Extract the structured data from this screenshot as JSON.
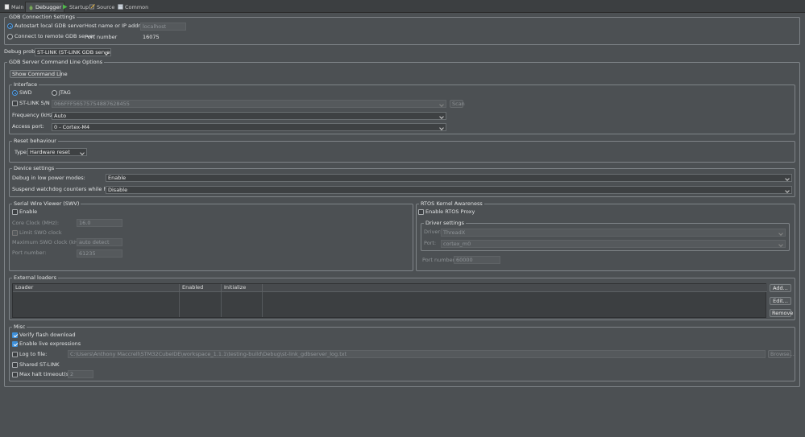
{
  "tabs": [
    {
      "label": "Main",
      "icon": "document-icon"
    },
    {
      "label": "Debugger",
      "icon": "bug-icon"
    },
    {
      "label": "Startup",
      "icon": "play-icon"
    },
    {
      "label": "Source",
      "icon": "source-icon"
    },
    {
      "label": "Common",
      "icon": "common-icon"
    }
  ],
  "gdb_connection": {
    "legend": "GDB Connection Settings",
    "autostart_label": "Autostart local GDB server",
    "remote_label": "Connect to remote GDB server",
    "host_label": "Host name or IP address",
    "host_value": "localhost",
    "port_label": "Port number",
    "port_value": "16075"
  },
  "debug_probe": {
    "label": "Debug probe",
    "value": "ST-LINK (ST-LINK GDB server)"
  },
  "server_options": {
    "legend": "GDB Server Command Line Options",
    "show_cmd_button": "Show Command Line",
    "interface": {
      "legend": "Interface",
      "swd_label": "SWD",
      "jtag_label": "JTAG",
      "stlink_sn_label": "ST-LINK S/N",
      "stlink_sn_value": "066FFF56575754887628455",
      "scan_button": "Scan",
      "freq_label": "Frequency (kHz):",
      "freq_value": "Auto",
      "access_label": "Access port:",
      "access_value": "0 - Cortex-M4"
    },
    "reset": {
      "legend": "Reset behaviour",
      "type_label": "Type:",
      "type_value": "Hardware reset"
    },
    "device": {
      "legend": "Device settings",
      "low_power_label": "Debug in low power modes:",
      "low_power_value": "Enable",
      "watchdog_label": "Suspend watchdog counters while halted:",
      "watchdog_value": "Disable"
    },
    "swv": {
      "legend": "Serial Wire Viewer (SWV)",
      "enable_label": "Enable",
      "core_clock_label": "Core Clock (MHz):",
      "core_clock_value": "16.0",
      "limit_swo_label": "Limit SWO clock",
      "max_swo_label": "Maximum SWO clock (kHz):",
      "max_swo_value": "auto detect",
      "port_label": "Port number:",
      "port_value": "61235"
    },
    "rtos": {
      "legend": "RTOS Kernel Awareness",
      "enable_label": "Enable RTOS Proxy",
      "driver_settings_legend": "Driver settings",
      "driver_label": "Driver:",
      "driver_value": "ThreadX",
      "port_label": "Port:",
      "port_value": "cortex_m0",
      "port_number_label": "Port number:",
      "port_number_value": "60000"
    },
    "loaders": {
      "legend": "External loaders",
      "columns": [
        "Loader",
        "Enabled",
        "Initialize"
      ],
      "add_button": "Add...",
      "edit_button": "Edit...",
      "remove_button": "Remove"
    },
    "misc": {
      "legend": "Misc",
      "verify_label": "Verify flash download",
      "live_expr_label": "Enable live expressions",
      "log_label": "Log to file:",
      "log_value": "C:\\Users\\Anthony Maccrell\\STM32CubeIDE\\workspace_1.1.1\\testing-build\\Debug\\st-link_gdbserver_log.txt",
      "browse_button": "Browse...",
      "shared_label": "Shared ST-LINK",
      "max_halt_label": "Max halt timeout(s):",
      "max_halt_value": "2"
    }
  },
  "colors": {
    "background": "#4c5053",
    "accent": "#3d8fd9"
  }
}
